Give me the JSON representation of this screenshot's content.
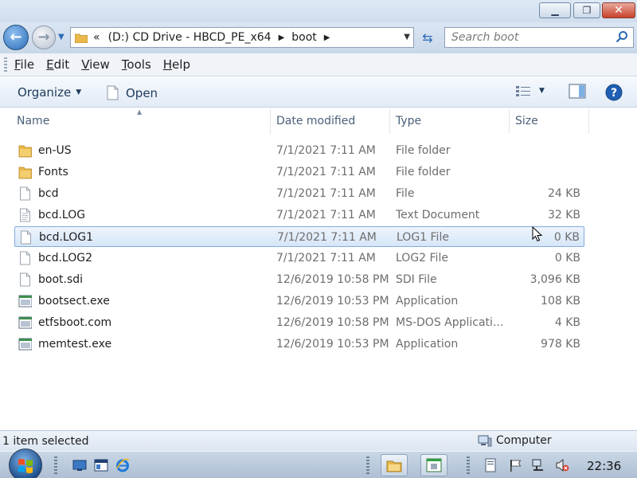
{
  "window": {
    "caption_buttons": [
      "minimize",
      "maximize",
      "close"
    ]
  },
  "nav": {
    "breadcrumb": [
      {
        "label": "«"
      },
      {
        "label": "(D:) CD Drive - HBCD_PE_x64"
      },
      {
        "label": "boot"
      }
    ],
    "search_placeholder": "Search boot"
  },
  "menu": {
    "items": [
      {
        "accel": "F",
        "rest": "ile"
      },
      {
        "accel": "E",
        "rest": "dit"
      },
      {
        "accel": "V",
        "rest": "iew"
      },
      {
        "accel": "T",
        "rest": "ools"
      },
      {
        "accel": "H",
        "rest": "elp"
      }
    ]
  },
  "commands": {
    "organize": "Organize",
    "open": "Open"
  },
  "columns": {
    "name": "Name",
    "date": "Date modified",
    "type": "Type",
    "size": "Size"
  },
  "files": [
    {
      "name": "en-US",
      "date": "7/1/2021 7:11 AM",
      "type": "File folder",
      "size": "",
      "icon": "folder-icon"
    },
    {
      "name": "Fonts",
      "date": "7/1/2021 7:11 AM",
      "type": "File folder",
      "size": "",
      "icon": "folder-icon"
    },
    {
      "name": "bcd",
      "date": "7/1/2021 7:11 AM",
      "type": "File",
      "size": "24 KB",
      "icon": "file-icon"
    },
    {
      "name": "bcd.LOG",
      "date": "7/1/2021 7:11 AM",
      "type": "Text Document",
      "size": "32 KB",
      "icon": "text-document-icon"
    },
    {
      "name": "bcd.LOG1",
      "date": "7/1/2021 7:11 AM",
      "type": "LOG1 File",
      "size": "0 KB",
      "icon": "file-icon",
      "selected": true
    },
    {
      "name": "bcd.LOG2",
      "date": "7/1/2021 7:11 AM",
      "type": "LOG2 File",
      "size": "0 KB",
      "icon": "file-icon"
    },
    {
      "name": "boot.sdi",
      "date": "12/6/2019 10:58 PM",
      "type": "SDI File",
      "size": "3,096 KB",
      "icon": "file-icon"
    },
    {
      "name": "bootsect.exe",
      "date": "12/6/2019 10:53 PM",
      "type": "Application",
      "size": "108 KB",
      "icon": "application-icon"
    },
    {
      "name": "etfsboot.com",
      "date": "12/6/2019 10:58 PM",
      "type": "MS-DOS Applicati...",
      "size": "4 KB",
      "icon": "application-icon"
    },
    {
      "name": "memtest.exe",
      "date": "12/6/2019 10:53 PM",
      "type": "Application",
      "size": "978 KB",
      "icon": "application-icon"
    }
  ],
  "status": {
    "selection": "1 item selected",
    "location": "Computer"
  },
  "taskbar": {
    "clock": "22:36"
  },
  "colors": {
    "selection_border": "#84acdd",
    "selection_fill": "#d6e6f8",
    "folder": "#e8b84a",
    "link_blue": "#1e3b5c"
  }
}
